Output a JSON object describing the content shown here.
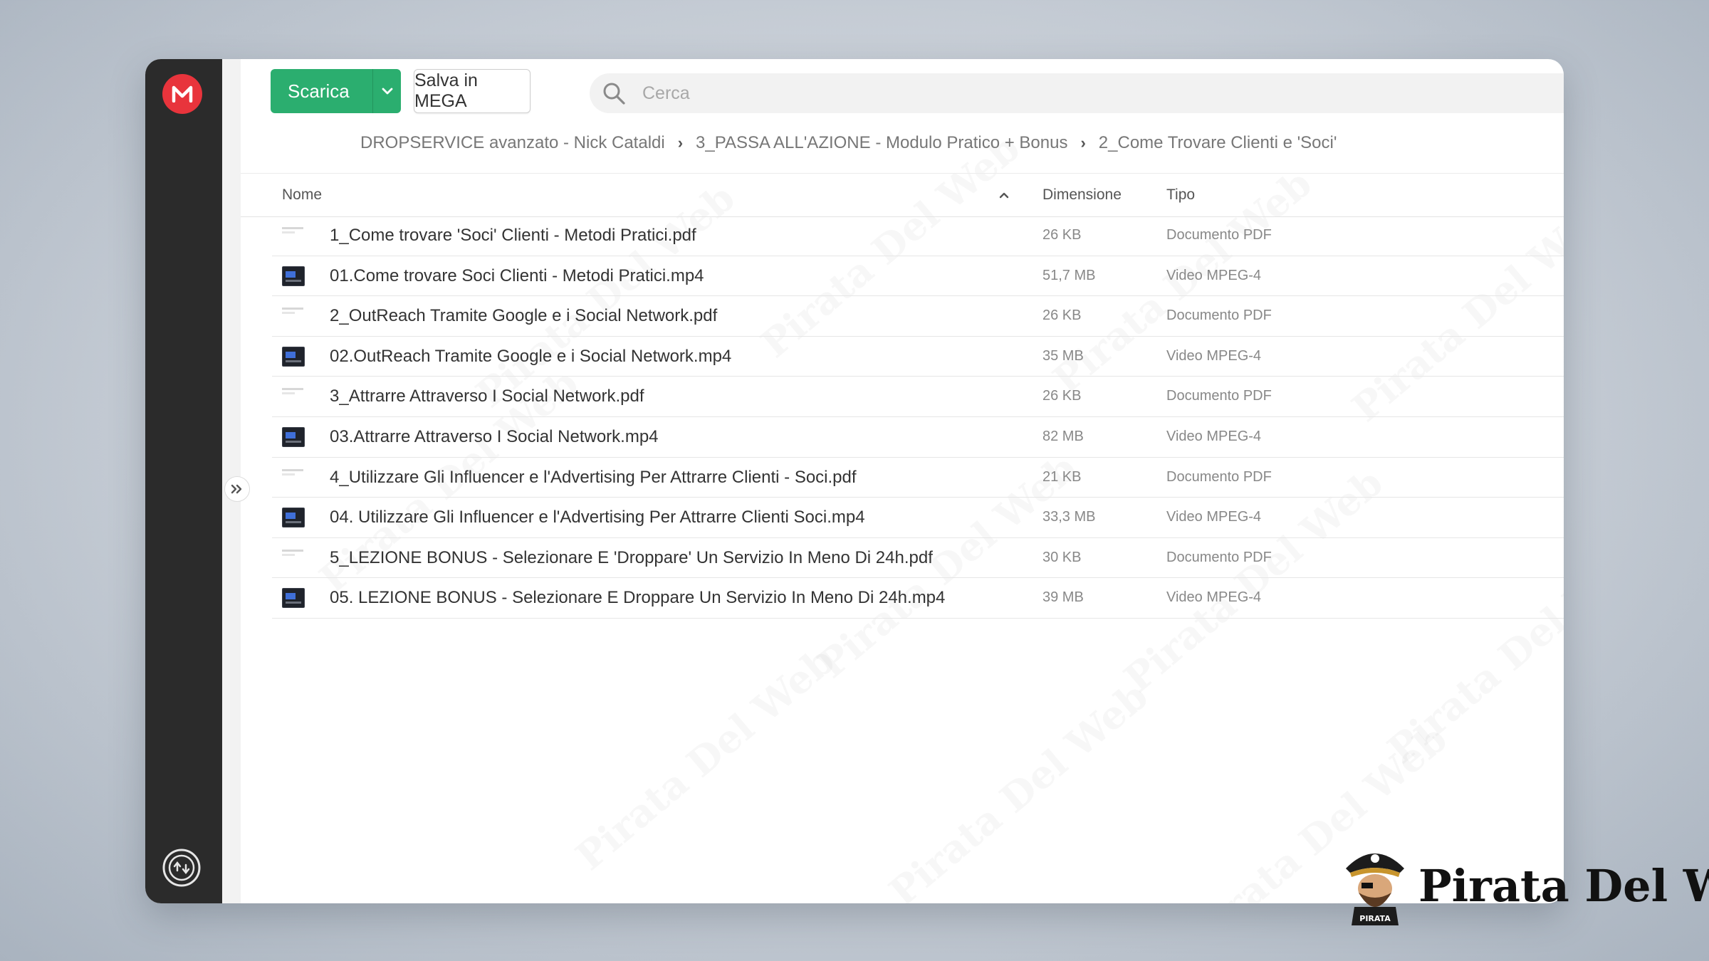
{
  "toolbar": {
    "download_label": "Scarica",
    "save_label": "Salva in MEGA"
  },
  "search": {
    "placeholder": "Cerca"
  },
  "breadcrumb": [
    "DROPSERVICE avanzato - Nick Cataldi",
    "3_PASSA ALL'AZIONE - Modulo Pratico + Bonus",
    "2_Come Trovare Clienti e 'Soci'"
  ],
  "table": {
    "columns": {
      "name": "Nome",
      "size": "Dimensione",
      "type": "Tipo"
    },
    "sort": "ascending",
    "rows": [
      {
        "icon": "pdf-file-icon",
        "name": "1_Come trovare 'Soci' Clienti - Metodi Pratici.pdf",
        "size": "26 KB",
        "type": "Documento PDF"
      },
      {
        "icon": "video-file-icon",
        "name": "01.Come trovare Soci Clienti - Metodi Pratici.mp4",
        "size": "51,7 MB",
        "type": "Video MPEG-4"
      },
      {
        "icon": "pdf-file-icon",
        "name": "2_OutReach Tramite Google e i Social Network.pdf",
        "size": "26 KB",
        "type": "Documento PDF"
      },
      {
        "icon": "video-file-icon",
        "name": "02.OutReach Tramite Google e i Social Network.mp4",
        "size": "35 MB",
        "type": "Video MPEG-4"
      },
      {
        "icon": "pdf-file-icon",
        "name": "3_Attrarre Attraverso I Social Network.pdf",
        "size": "26 KB",
        "type": "Documento PDF"
      },
      {
        "icon": "video-file-icon",
        "name": "03.Attrarre Attraverso I Social Network.mp4",
        "size": "82 MB",
        "type": "Video MPEG-4"
      },
      {
        "icon": "pdf-file-icon",
        "name": "4_Utilizzare Gli Influencer e l'Advertising Per Attrarre Clienti - Soci.pdf",
        "size": "21 KB",
        "type": "Documento PDF"
      },
      {
        "icon": "video-file-icon",
        "name": "04. Utilizzare Gli Influencer e l'Advertising Per Attrarre Clienti Soci.mp4",
        "size": "33,3 MB",
        "type": "Video MPEG-4"
      },
      {
        "icon": "pdf-file-icon",
        "name": "5_LEZIONE BONUS - Selezionare E 'Droppare' Un Servizio In Meno Di 24h.pdf",
        "size": "30 KB",
        "type": "Documento PDF"
      },
      {
        "icon": "video-file-icon",
        "name": "05. LEZIONE BONUS - Selezionare E Droppare Un Servizio In Meno Di 24h.mp4",
        "size": "39 MB",
        "type": "Video MPEG-4"
      }
    ]
  },
  "watermark_text": "Pirata Del Web",
  "brand": {
    "name": "Pirata Del Web",
    "badge": "PIRATA"
  },
  "colors": {
    "download_button": "#2bae6f",
    "mega_logo": "#e8343c",
    "sidebar": "#2b2b2b"
  }
}
